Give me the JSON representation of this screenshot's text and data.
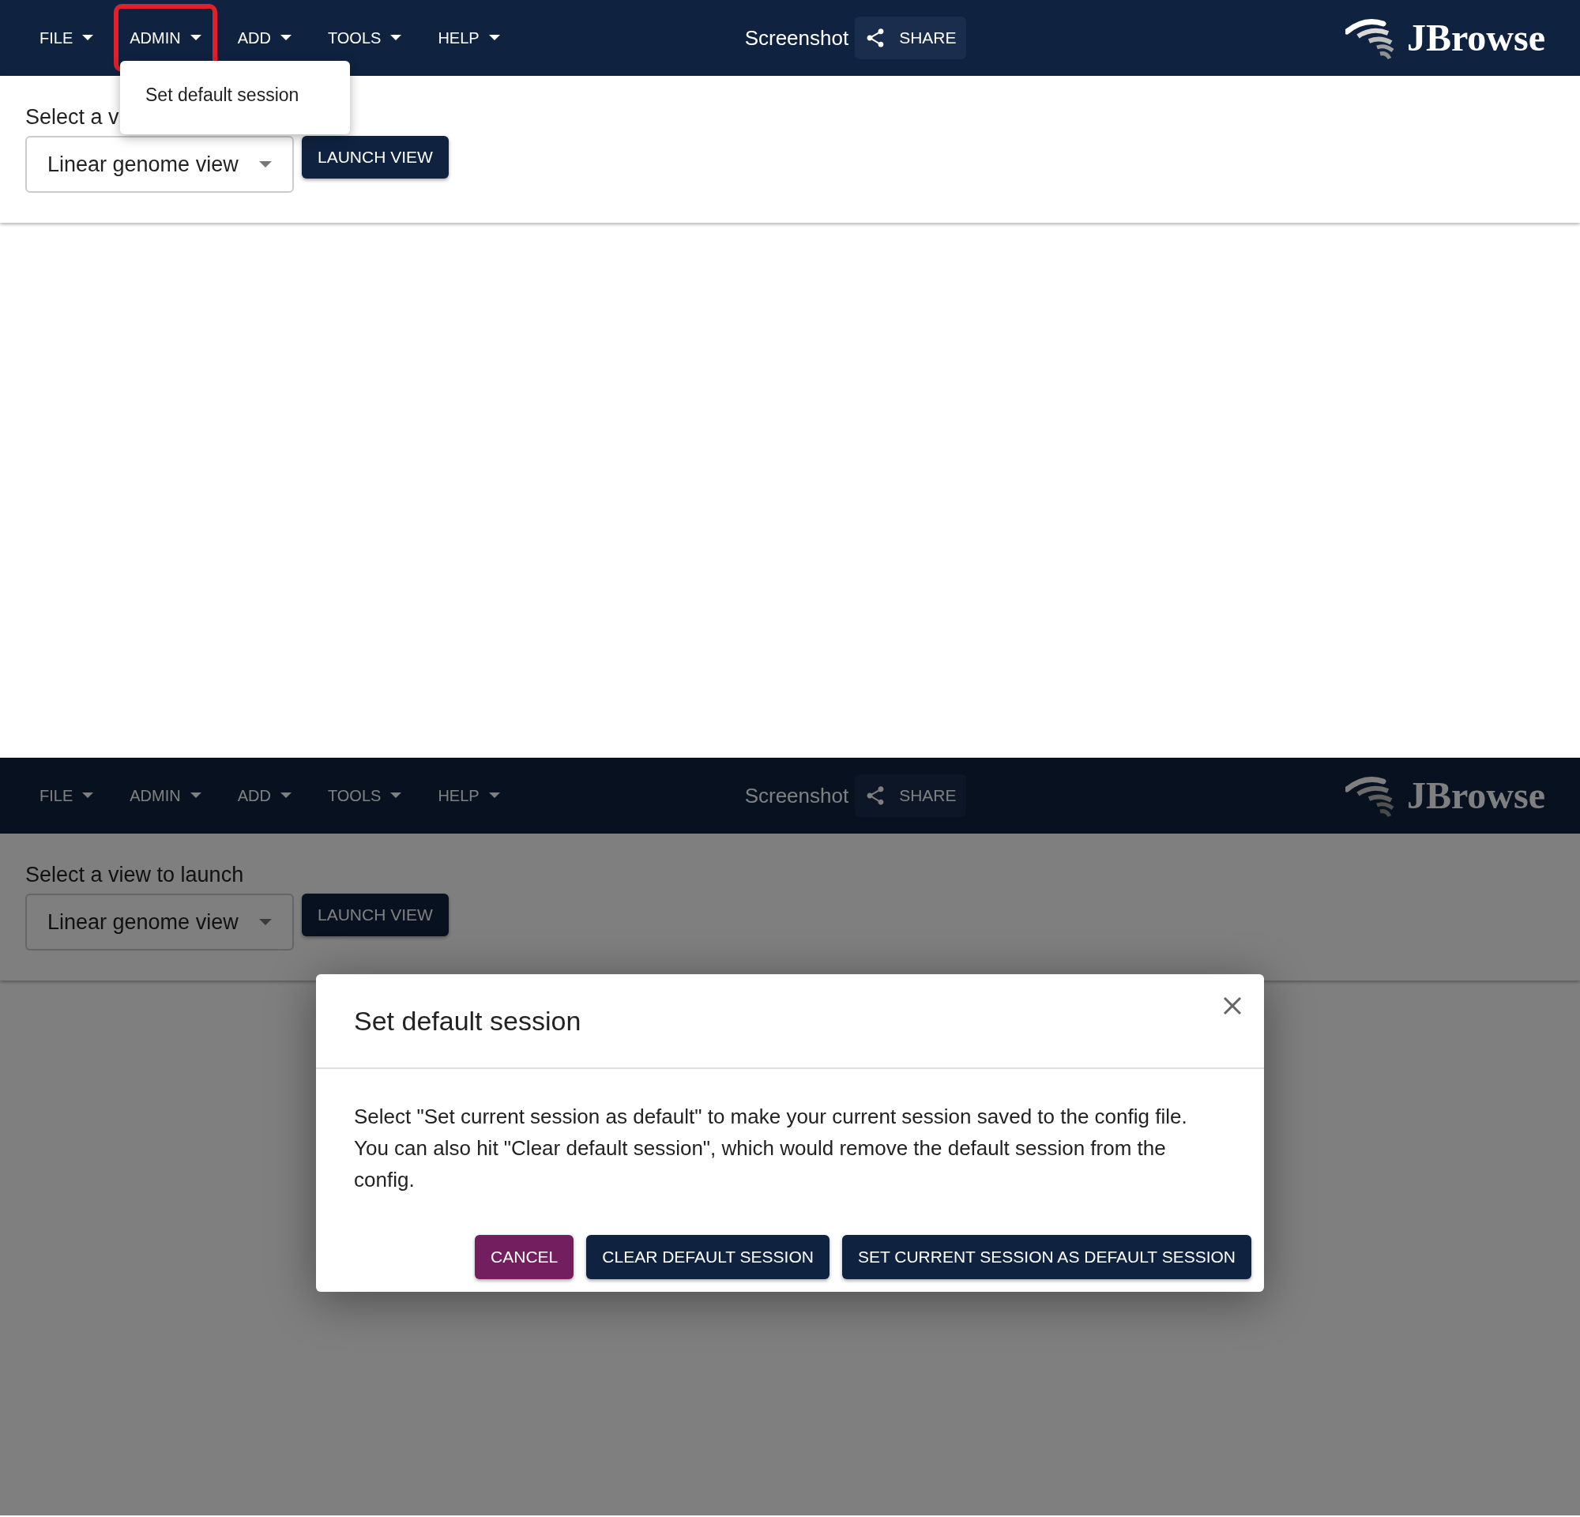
{
  "panels": [
    {
      "menus": [
        {
          "label": "FILE",
          "highlighted": false
        },
        {
          "label": "ADMIN",
          "highlighted": true
        },
        {
          "label": "ADD",
          "highlighted": false
        },
        {
          "label": "TOOLS",
          "highlighted": false
        },
        {
          "label": "HELP",
          "highlighted": false
        }
      ],
      "screenshot_label": "Screenshot",
      "share_button": "SHARE",
      "logo": "JBrowse",
      "view_label": "Select a v",
      "view_select": "Linear genome view",
      "launch_button": "LAUNCH VIEW",
      "open_menu": {
        "items": [
          "Set default session"
        ]
      }
    },
    {
      "menus": [
        {
          "label": "FILE",
          "highlighted": false
        },
        {
          "label": "ADMIN",
          "highlighted": false
        },
        {
          "label": "ADD",
          "highlighted": false
        },
        {
          "label": "TOOLS",
          "highlighted": false
        },
        {
          "label": "HELP",
          "highlighted": false
        }
      ],
      "screenshot_label": "Screenshot",
      "share_button": "SHARE",
      "logo": "JBrowse",
      "view_label": "Select a view to launch",
      "view_select": "Linear genome view",
      "launch_button": "LAUNCH VIEW",
      "dialog": {
        "title": "Set default session",
        "text": "Select \"Set current session as default\" to make your current session saved to the config file. You can also hit \"Clear default session\", which would remove the default session from the config.",
        "buttons": [
          {
            "label": "CANCEL",
            "kind": "secondary"
          },
          {
            "label": "CLEAR DEFAULT SESSION",
            "kind": "primary"
          },
          {
            "label": "SET CURRENT SESSION AS DEFAULT SESSION",
            "kind": "primary"
          }
        ]
      }
    }
  ]
}
